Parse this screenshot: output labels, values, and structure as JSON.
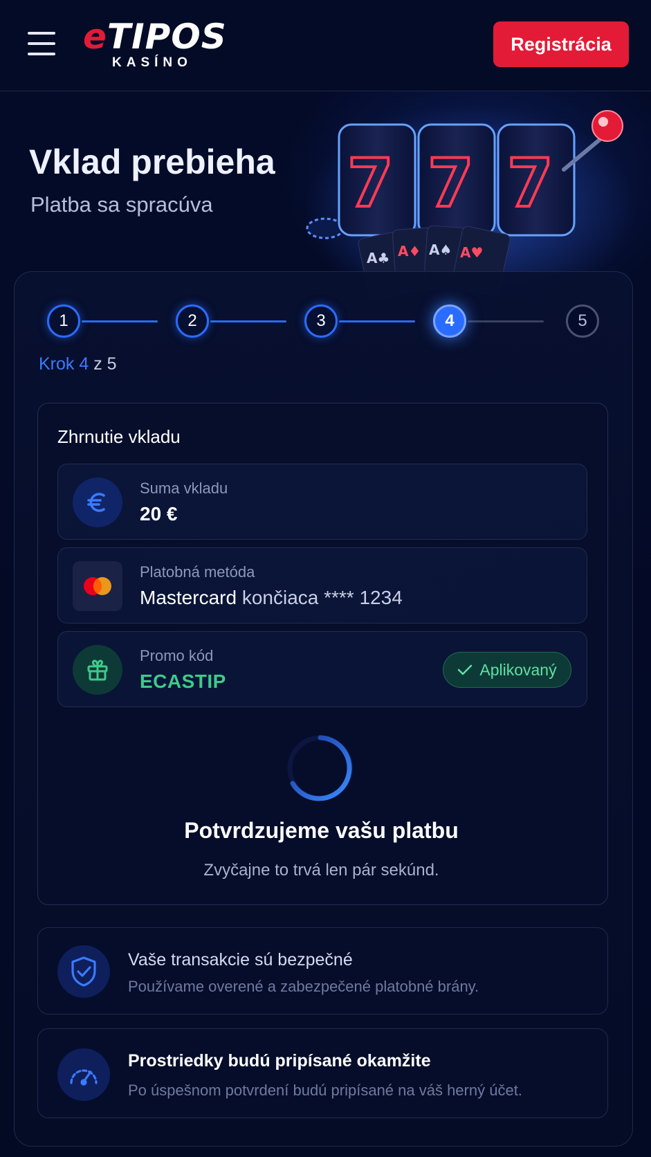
{
  "header": {
    "logo_e": "e",
    "logo_main": "TIPOS",
    "logo_sub": "KASÍNO",
    "register_label": "Registrácia"
  },
  "hero": {
    "title": "Vklad prebieha",
    "subtitle": "Platba sa spracúva"
  },
  "stepper": {
    "steps": [
      "1",
      "2",
      "3",
      "4",
      "5"
    ],
    "current": 4,
    "label_prefix": "Krok 4",
    "label_suffix": "z 5"
  },
  "summary": {
    "title": "Zhrnutie vkladu",
    "amount": {
      "label": "Suma vkladu",
      "value": "20 €",
      "icon": "euro-icon"
    },
    "method": {
      "label": "Platobná metóda",
      "brand": "Mastercard",
      "detail": "končiaca **** 1234",
      "icon": "mastercard-icon"
    },
    "promo": {
      "label": "Promo kód",
      "value": "ECASTIP",
      "badge": "Aplikovaný",
      "icon": "gift-icon"
    }
  },
  "status": {
    "title": "Potvrdzujeme vašu platbu",
    "subtitle": "Zvyčajne to trvá len pár sekúnd."
  },
  "info": [
    {
      "title": "Vaše transakcie sú bezpečné",
      "text": "Používame overené a zabezpečené platobné brány.",
      "icon": "shield-check-icon"
    },
    {
      "title": "Prostriedky budú pripísané okamžite",
      "text": "Po úspešnom potvrdení budú pripísané na váš herný účet.",
      "icon": "speedometer-icon"
    }
  ],
  "colors": {
    "background": "#030a26",
    "brand_red": "#e31b37",
    "accent_blue": "#2a6cff",
    "success_green": "#3dcb8a"
  }
}
